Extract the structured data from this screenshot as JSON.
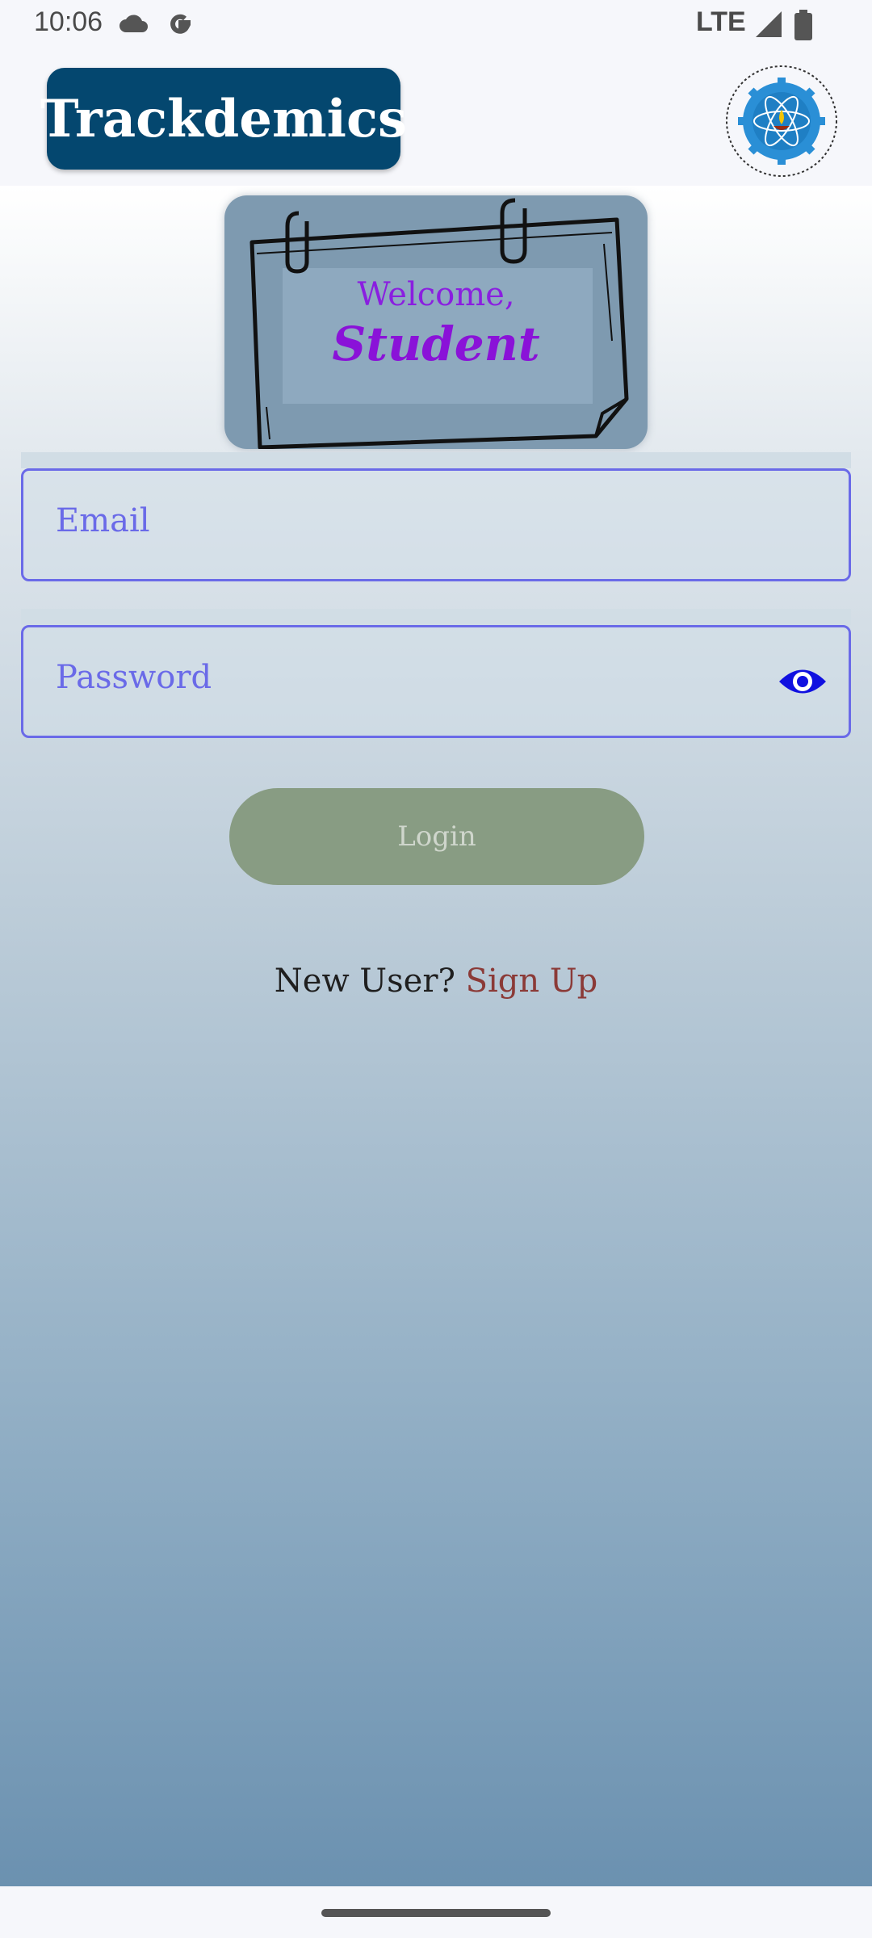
{
  "status_bar": {
    "time": "10:06",
    "network": "LTE",
    "icons": [
      "cloud-icon",
      "google-icon",
      "signal-icon",
      "battery-icon"
    ]
  },
  "header": {
    "app_title": "Trackdemics",
    "logo_icon": "institute-logo-icon"
  },
  "welcome_card": {
    "greeting": "Welcome,",
    "role": "Student"
  },
  "form": {
    "email_placeholder": "Email",
    "password_placeholder": "Password",
    "password_toggle_icon": "eye-icon",
    "login_label": "Login"
  },
  "signup": {
    "prompt": "New User?",
    "link_label": "Sign Up"
  },
  "colors": {
    "brand": "#04476f",
    "field_accent": "#6a6ae8",
    "login_button": "#889c83",
    "signup_link": "#8b3a37",
    "welcome_text": "#8a12d8"
  }
}
